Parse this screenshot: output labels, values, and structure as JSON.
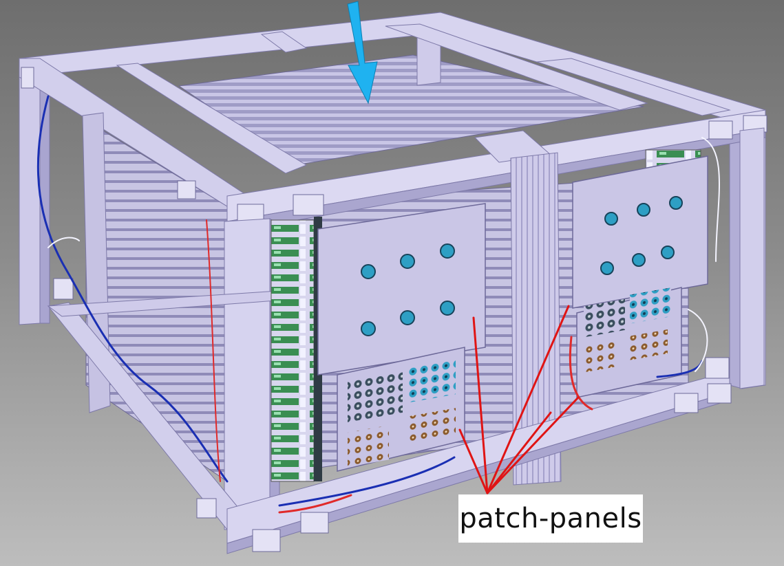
{
  "annotation": {
    "label": "patch-panels"
  },
  "colors": {
    "frame": "#d4d0ef",
    "frame_shade": "#aaa6cf",
    "panel": "#c7c3e4",
    "arrow": "#1fb2f0",
    "leader_lines": "#e01414",
    "connector_blue": "#2e9fc4",
    "connector_dark": "#283c4c",
    "connector_bronze": "#8a5a2c",
    "electronics_green": "#3fa35a",
    "cable_blue": "#1a2fb3",
    "cable_red": "#e02a2a"
  },
  "icons": [
    "down-arrow-icon"
  ]
}
